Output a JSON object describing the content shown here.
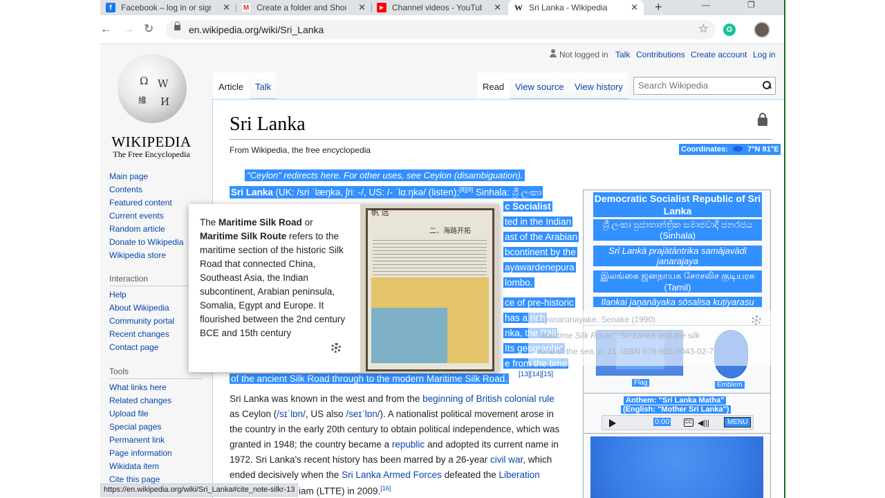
{
  "tabs": [
    {
      "title": "Facebook – log in or sign up",
      "icon": "facebook-icon",
      "color": "#1877f2",
      "glyph": "f"
    },
    {
      "title": "Create a folder and Short",
      "icon": "gmail-icon",
      "color": "#d93025",
      "glyph": "M"
    },
    {
      "title": "Channel videos - YouTube",
      "icon": "youtube-icon",
      "color": "#ff0000",
      "glyph": "▶"
    },
    {
      "title": "Sri Lanka - Wikipedia",
      "icon": "wikipedia-icon",
      "color": "#ffffff",
      "glyph": "W"
    }
  ],
  "browser": {
    "url": "en.wikipedia.org/wiki/Sri_Lanka",
    "status_url": "https://en.wikipedia.org/wiki/Sri_Lanka#cite_note-silkr-13"
  },
  "logo": {
    "wordmark": "WIKIPEDIA",
    "tagline": "The Free Encyclopedia"
  },
  "nav_main": [
    "Main page",
    "Contents",
    "Featured content",
    "Current events",
    "Random article",
    "Donate to Wikipedia",
    "Wikipedia store"
  ],
  "nav_interaction_heading": "Interaction",
  "nav_interaction": [
    "Help",
    "About Wikipedia",
    "Community portal",
    "Recent changes",
    "Contact page"
  ],
  "nav_tools_heading": "Tools",
  "nav_tools": [
    "What links here",
    "Related changes",
    "Upload file",
    "Special pages",
    "Permanent link",
    "Page information",
    "Wikidata item",
    "Cite this page"
  ],
  "personal": {
    "not_logged": "Not logged in",
    "talk": "Talk",
    "contributions": "Contributions",
    "create": "Create account",
    "login": "Log in"
  },
  "page_tabs": {
    "article": "Article",
    "talk": "Talk",
    "read": "Read",
    "view_source": "View source",
    "view_history": "View history"
  },
  "search": {
    "placeholder": "Search Wikipedia"
  },
  "article": {
    "title": "Sri Lanka",
    "from": "From Wikipedia, the free encyclopedia",
    "coordinates_label": "Coordinates:",
    "coordinates_value": "7°N 81°E",
    "hatnote": "\"Ceylon\" redirects here. For other uses, see Ceylon (disambiguation).",
    "lead_1": "Sri Lanka",
    "lead_1_rest": " (UK: /sri ˈlæŋkə, ʃriː -/, US: /- ˈlɑːŋkə/ (",
    "lead_1_listen": "listen);",
    "lead_1_refs": "[8][9]",
    "lead_1_sinhala": " Sinhala: ශ්‍රී ලංකා",
    "frag_socialist": "c Socialist",
    "frag_indian": "ted in the Indian",
    "frag_arabian": "ast of the Arabian",
    "frag_subcontinent": "bcontinent by the",
    "frag_jayawardene": "ayawardenepura",
    "frag_colombo": "lombo.",
    "frag_prehistoric": "ce of pre-historic",
    "frag_rich": "has a rich",
    "frag_pali": "nka, the Pāli",
    "frag_geographic": "Its geographic",
    "frag_time": "e from the time",
    "silk_line": "of the ancient Silk Road through to the modern Maritime Silk Road.",
    "silk_refs": "[13][14][15]",
    "para2_1a": "Sri Lanka was known in the west and from the ",
    "para2_1b": "beginning of British colonial rule",
    "para2_2a": "as Ceylon (",
    "para2_2b": "/sɪˈlɒn/",
    "para2_2c": ", US also ",
    "para2_2d": "/seɪˈlɒn/",
    "para2_2e": "). A nationalist political movement arose in",
    "para2_3": "the country in the early 20th century to obtain political independence, which was",
    "para2_4a": "granted in 1948; the country became a ",
    "para2_4b": "republic",
    "para2_4c": " and adopted its current name in",
    "para2_5a": "1972. Sri Lanka's recent history has been marred by a 26-year ",
    "para2_5b": "civil war",
    "para2_5c": ", which",
    "para2_6a": "ended decisively when the ",
    "para2_6b": "Sri Lanka Armed Forces",
    "para2_6c": " defeated the ",
    "para2_6d": "Liberation",
    "para2_7a": "iam (LTTE) in 2009.",
    "para2_7b": "[16]"
  },
  "infobox": {
    "title": "Democratic Socialist Republic of Sri Lanka",
    "sinhala": "ශ්‍රී ලංකා ප්‍රජාතාන්ත්‍රික සමාජවාදී ජනරජය (Sinhala)",
    "romanized_si": "Srī Lankā prajātāntrika samājavādī janarajaya",
    "tamil": "இலங்கை ஜனநாயக சோசலிச குடியரசு (Tamil)",
    "romanized_ta": "Ilankai jaṉanāyaka sōsalisa kuṭiyarasu",
    "flag_caption": "Flag",
    "emblem_caption": "Emblem",
    "anthem": "Anthem: \"Sri Lanka Matha\"",
    "anthem_en": "(English: \"Mother Sri Lanka\")",
    "audio_time": "0:00",
    "audio_menu": "MENU"
  },
  "popup": {
    "term1": "Maritime Silk Road",
    "term2": "Maritime Silk Route",
    "text_a": "The ",
    "text_b": " or ",
    "text_c": " refers to the maritime section of the historic Silk Road that connected China, Southeast Asia, the Indian subcontinent, Arabian peninsula, Somalia, Egypt and Europe. It flourished between the 2nd century BCE and 15th century",
    "img_heading": "二、海路开拓",
    "img_sign": "帆 远"
  },
  "ghost": {
    "line1": "Liyanaranayake, Senake (1990)",
    "line2": "\"Maritime Silk Route\". Sri Lanka and the silk",
    "line3": "road of the sea. p. 21. ISBN 978-955-9043-02-7"
  }
}
